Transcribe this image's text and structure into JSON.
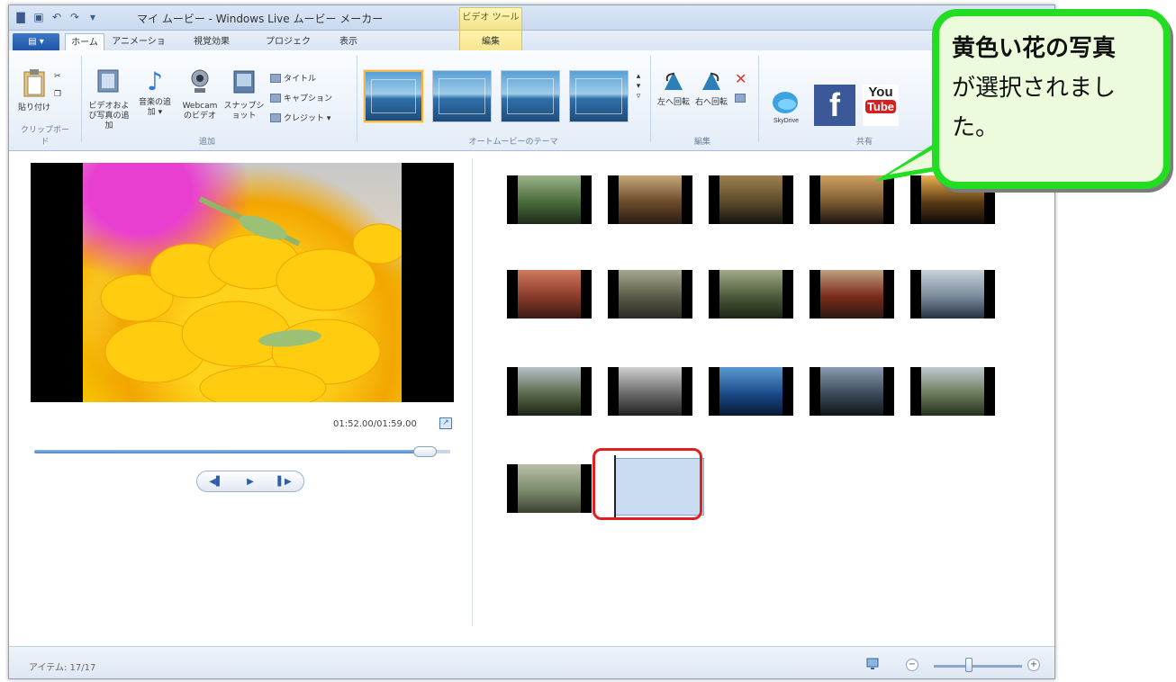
{
  "window": {
    "title": "マイ ムービー - Windows Live ムービー メーカー",
    "context_tab_group": "ビデオ ツール"
  },
  "tabs": {
    "file": "▤ ▾",
    "items": [
      "ホーム",
      "アニメーション",
      "視覚効果",
      "プロジェクト",
      "表示",
      "編集"
    ],
    "active": "ホーム"
  },
  "ribbon": {
    "paste": "貼り付け",
    "clipboard_group": "クリップボード",
    "add_video": "ビデオおよび写真の追加",
    "add_music": "音楽の追加 ▾",
    "webcam": "Webcam のビデオ",
    "snapshot": "スナップショット",
    "title_btn": "タイトル",
    "caption_btn": "キャプション",
    "credits_btn": "クレジット ▾",
    "add_group": "追加",
    "theme_group": "オートムービーのテーマ",
    "rotate_left": "左へ回転",
    "rotate_right": "右へ回転",
    "edit_group": "編集",
    "share_group": "共有",
    "skydrive": "SkyDrive",
    "youtube_top": "You",
    "youtube_bottom": "Tube"
  },
  "preview": {
    "timecode": "01:52.00/01:59.00",
    "progress": 0.94
  },
  "status": {
    "items": "アイテム: 17/17"
  },
  "callout": {
    "line1": "黄色い花の写真",
    "line2": "が選択されまし",
    "line3": "た。"
  },
  "colors": {
    "callout_border": "#22dd22",
    "selection_outline": "#e02020",
    "file_tab": "#1f56a8"
  }
}
